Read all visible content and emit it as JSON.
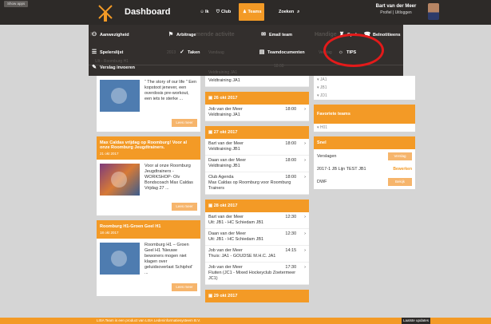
{
  "header": {
    "show_apps": "Show apps",
    "brand": "Dashboard",
    "nav": [
      {
        "label": "Ik",
        "icon": "person-icon"
      },
      {
        "label": "Club",
        "icon": "shield-icon"
      },
      {
        "label": "Teams",
        "icon": "teams-icon"
      }
    ],
    "search_label": "Zoeken",
    "user_name": "Bart van der Meer",
    "user_profile": "Profiel",
    "user_logout": "Uitloggen"
  },
  "menu": {
    "row1": [
      {
        "label": "Aanwezigheid",
        "icon": "people-icon"
      },
      {
        "label": "Arbitrage",
        "icon": "whistle-icon"
      },
      {
        "label": "Email team",
        "icon": "mail-icon"
      },
      {
        "label": "Spel",
        "icon": "hockey-icon"
      },
      {
        "label": "Belnotitieens",
        "icon": "phone-icon"
      }
    ],
    "row2": [
      {
        "label": "Spelerslijst",
        "icon": "list-icon"
      },
      {
        "label": "Taken",
        "icon": "check-icon"
      },
      {
        "label": "Teamdocumenten",
        "icon": "document-icon"
      },
      {
        "label": "TIPS",
        "icon": "lightbulb-icon"
      }
    ],
    "row3": {
      "label": "Verslag invoeren",
      "icon": "pencil-icon"
    },
    "background_headings": [
      "Ni",
      "mende activite",
      "Handige"
    ],
    "background_small": [
      "UIt - Roomburg H1",
      "2013",
      "Verslag",
      "Vandaag",
      "Veldtraining JA1",
      "18:00"
    ]
  },
  "news": [
    {
      "title": "",
      "text": "“ The story of our life ” Een kopstoot jenever, een overdosis pre-workout, een iets te sterke ...",
      "button": "Lees meer",
      "image": "hockey-player-icon"
    },
    {
      "title": "Max Caldas vrijdag op Roomburg! Voor al onze Roomburg Jeugdtrainers.",
      "date": "21 okt 2017",
      "text": "Voor al onze Roomburg Jeugdtrainers - WORKSHOP- Olv Bondscoach Max Caldas Vrijdag 27 ...",
      "button": "Lees meer",
      "image": "photo"
    },
    {
      "title": "Roomburg H1-Groen Geel H1",
      "date": "18 okt 2017",
      "text": "Roomburg H1 – Groen Geel H1 'Nieuwe bewoners mogen niet klagen over geluidsoverlast Schiphol' ...",
      "button": "Lees meer",
      "image": "hockey-player-icon"
    }
  ],
  "activities": [
    {
      "date": "",
      "items": [
        {
          "name": "",
          "time": "",
          "sub": "Veldtraining JA1"
        }
      ]
    },
    {
      "date": "26 okt 2017",
      "items": [
        {
          "name": "Job van der Meer",
          "time": "18:00",
          "sub": "Veldtraining JA1"
        }
      ]
    },
    {
      "date": "27 okt 2017",
      "items": [
        {
          "name": "Bart van der Meer",
          "time": "18:00",
          "sub": "Veldtraining JB1"
        },
        {
          "name": "Daan van der Meer",
          "time": "18:00",
          "sub": "Veldtraining JB1"
        },
        {
          "name": "Club Agenda",
          "time": "18:00",
          "sub": "Max Caldas op Roomburg voor Roomburg Trainers"
        }
      ]
    },
    {
      "date": "28 okt 2017",
      "items": [
        {
          "name": "Bart van der Meer",
          "time": "12:30",
          "sub": "Uit: JB1 - HC Schiedam JB1"
        },
        {
          "name": "Daan van der Meer",
          "time": "12:30",
          "sub": "Uit: JB1 - HC Schiedam JB1"
        },
        {
          "name": "Job van der Meer",
          "time": "14:15",
          "sub": "Thuis: JA1 - GOUDSE M.H.C. JA1"
        },
        {
          "name": "Job van der Meer",
          "time": "17:30",
          "sub": "Fluiten (JC1 - Mixed Hockeyclub Zoetermeer JC1)"
        }
      ]
    },
    {
      "date": "29 okt 2017",
      "items": []
    }
  ],
  "sidebar": {
    "ghost_rows": [
      "JA1",
      "JB1",
      "JD1"
    ],
    "fav_title": "Favoriete teams",
    "fav_rows": [
      "H01"
    ],
    "snel_title": "Snel",
    "snel": [
      {
        "label": "Verslagen",
        "action": "Verslag"
      },
      {
        "label": "2017-1 JB Lijn TEST JB1",
        "action": "Bewerken"
      },
      {
        "label": "DWF",
        "action": "Bekijk"
      }
    ]
  },
  "footer": {
    "text": "LISA Team is een product van LISA Ledeninformatiesysteem B.V.",
    "updates": "Laatste updates"
  },
  "colors": {
    "accent": "#f39a26",
    "dark": "#2d2a28",
    "highlight": "#e31a1a"
  }
}
